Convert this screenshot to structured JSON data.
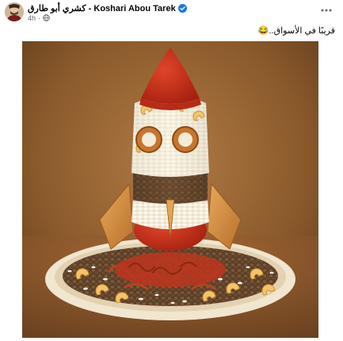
{
  "post": {
    "author": "كشري أبو طارق - Koshari Abou Tarek",
    "time": "4h",
    "text": "قريبًا في الأسواق..😂",
    "audience_icon": "globe-icon",
    "verified_icon": "verified-badge-icon",
    "more_icon": "more-options-icon"
  },
  "colors": {
    "verified_blue": "#1877f2",
    "meta_gray": "#65676b",
    "background": "#8b5a2b"
  }
}
